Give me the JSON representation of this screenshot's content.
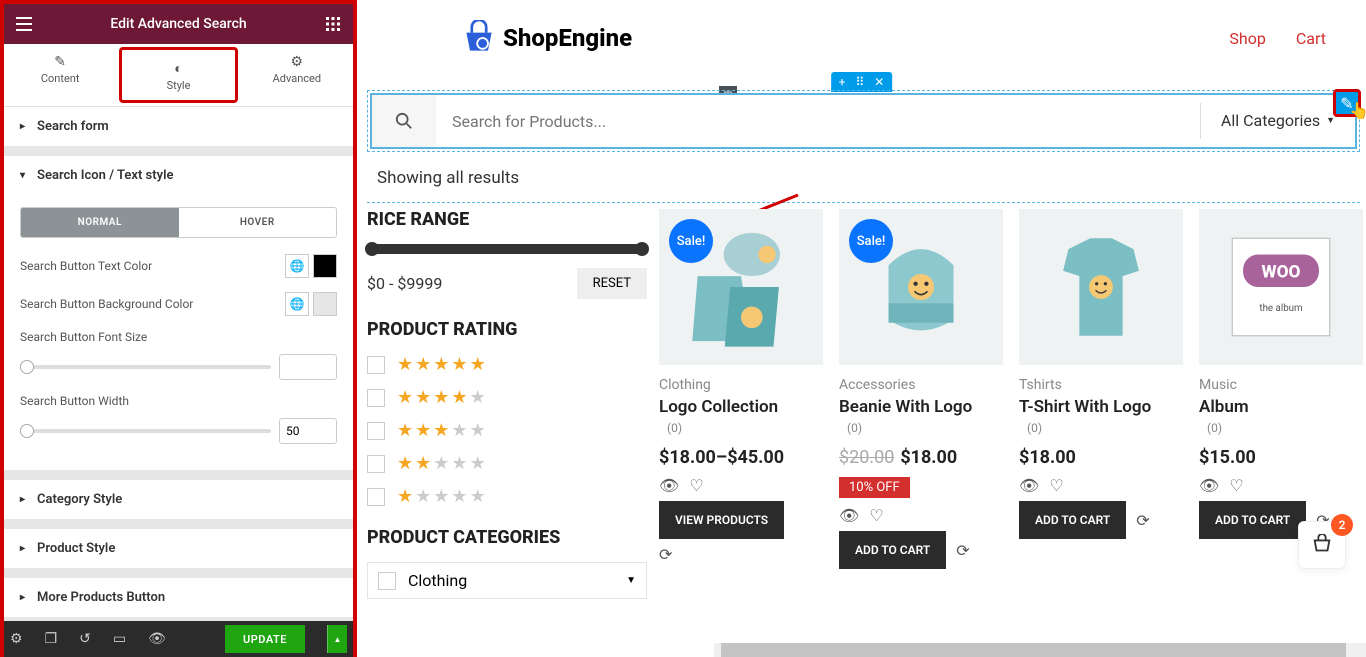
{
  "panel": {
    "title": "Edit Advanced Search",
    "tabs": {
      "content": "Content",
      "style": "Style",
      "advanced": "Advanced"
    },
    "accordions": {
      "search_form": "Search form",
      "search_icon": "Search Icon / Text style",
      "category_style": "Category Style",
      "product_style": "Product Style",
      "more_products": "More Products Button"
    },
    "state_tabs": {
      "normal": "NORMAL",
      "hover": "HOVER"
    },
    "controls": {
      "text_color": "Search Button Text Color",
      "bg_color": "Search Button Background Color",
      "font_size": "Search Button Font Size",
      "width": "Search Button Width",
      "width_value": "50"
    },
    "update_label": "UPDATE"
  },
  "site": {
    "logo_text": "ShopEngine",
    "nav": {
      "shop": "Shop",
      "cart": "Cart"
    }
  },
  "search": {
    "placeholder": "Search for Products...",
    "category": "All Categories"
  },
  "showing_text": "Showing all results",
  "filters": {
    "price_heading": "RICE RANGE",
    "price_range": "$0 - $9999",
    "reset": "RESET",
    "rating_heading": "PRODUCT RATING",
    "categories_heading": "PRODUCT CATEGORIES",
    "category1": "Clothing"
  },
  "products": [
    {
      "badge": "Sale!",
      "cat": "Clothing",
      "title": "Logo Collection",
      "reviews": "(0)",
      "price": "$18.00–$45.00",
      "btn": "VIEW PRODUCTS"
    },
    {
      "badge": "Sale!",
      "cat": "Accessories",
      "title": "Beanie With Logo",
      "reviews": "(0)",
      "old": "$20.00",
      "price": "$18.00",
      "discount": "10% OFF",
      "btn": "ADD TO CART"
    },
    {
      "cat": "Tshirts",
      "title": "T-Shirt With Logo",
      "reviews": "(0)",
      "price": "$18.00",
      "btn": "ADD TO CART"
    },
    {
      "cat": "Music",
      "title": "Album",
      "reviews": "(0)",
      "price": "$15.00",
      "btn": "ADD TO CART"
    }
  ],
  "cart_count": "2"
}
